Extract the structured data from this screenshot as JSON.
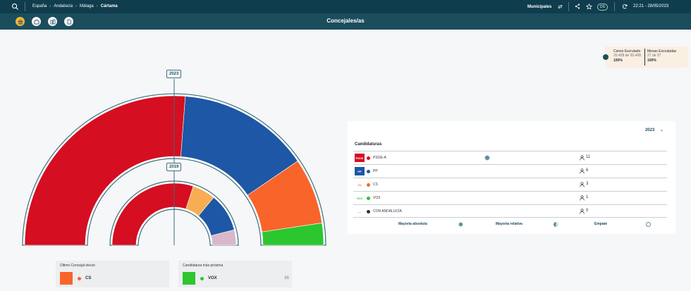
{
  "topbar": {
    "breadcrumbs": [
      "España",
      "Andalucía",
      "Málaga",
      "Cártama"
    ],
    "election": "Municipales",
    "round_badge": "DS",
    "datetime": "22:21 - 28/05/2023"
  },
  "subbar": {
    "title": "Concejales/as",
    "chips": [
      "ayuntamiento-icon",
      "municipio-icon",
      "comparar-icon",
      "documento-icon"
    ]
  },
  "hemicycle": {
    "outer_year": "2023",
    "inner_year": "2019",
    "outer_seats": [
      {
        "party": "PSOE-A",
        "seats": 11,
        "color": "#d50e21"
      },
      {
        "party": "PP",
        "seats": 6,
        "color": "#1d57a5"
      },
      {
        "party": "CS",
        "seats": 3,
        "color": "#f9642a"
      },
      {
        "party": "VOX",
        "seats": 1,
        "color": "#2cc62f"
      }
    ],
    "inner_share": [
      {
        "party": "PSOE-A",
        "fraction": 0.6,
        "color": "#d50e21"
      },
      {
        "party": "CS",
        "fraction": 0.12,
        "color": "#f7ae52"
      },
      {
        "party": "PP",
        "fraction": 0.2,
        "color": "#1d57a5"
      },
      {
        "party": "Otros",
        "fraction": 0.08,
        "color": "#d8b8ca"
      }
    ]
  },
  "census": {
    "censo_label": "Censo Escrutado",
    "censo_sub": "20.428 de 20.428",
    "censo_value": "100%",
    "mesas_label": "Mesas Escrutadas",
    "mesas_sub": "27 de 27",
    "mesas_value": "100%"
  },
  "panel": {
    "year": "2023",
    "header": "Candidaturas",
    "rows": [
      {
        "logo": "PSOE",
        "name": "PSOE-A",
        "seats": "11",
        "color": "#d50e21",
        "logo_bg": "#d50e21",
        "logo_fg": "#ffffff"
      },
      {
        "logo": "PP",
        "name": "PP",
        "seats": "6",
        "color": "#1d57a5",
        "logo_bg": "#1d57a5",
        "logo_fg": "#ffffff"
      },
      {
        "logo": "Cs",
        "name": "CS",
        "seats": "3",
        "color": "#f9642a",
        "logo_bg": "#ffffff",
        "logo_fg": "#f9642a"
      },
      {
        "logo": "VOX",
        "name": "VOX",
        "seats": "1",
        "color": "#2cc62f",
        "logo_bg": "#ffffff",
        "logo_fg": "#2cc62f"
      },
      {
        "logo": "—",
        "name": "CON ANDALUCÍA",
        "seats": "0",
        "color": "#333333",
        "logo_bg": "#ffffff",
        "logo_fg": "#888888"
      }
    ],
    "legend": {
      "absoluta": "Mayoría absoluta",
      "relativa": "Mayoría relativa",
      "empate": "Empate"
    }
  },
  "cards": {
    "ultimo": {
      "title": "Último Concejal electo",
      "party": "CS",
      "color": "#f9642a"
    },
    "proxima": {
      "title": "Candidatura más próxima",
      "party": "VOX",
      "value": "86",
      "color": "#2cc62f"
    }
  }
}
